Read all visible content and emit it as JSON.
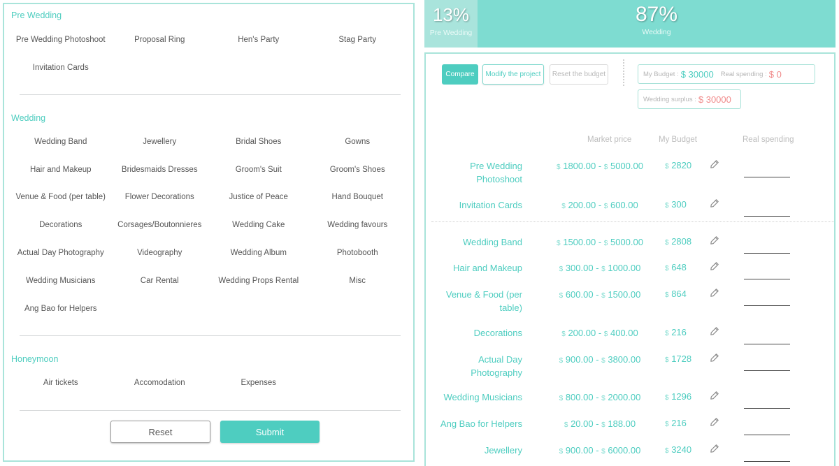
{
  "left": {
    "sections": [
      {
        "title": "Pre Wedding",
        "items": [
          "Pre Wedding Photoshoot",
          "Proposal Ring",
          "Hen's Party",
          "Stag Party",
          "Invitation Cards"
        ]
      },
      {
        "title": "Wedding",
        "items": [
          "Wedding Band",
          "Jewellery",
          "Bridal Shoes",
          "Gowns",
          "Hair and Makeup",
          "Bridesmaids Dresses",
          "Groom's Suit",
          "Groom's Shoes",
          "Venue & Food (per table)",
          "Flower Decorations",
          "Justice of Peace",
          "Hand Bouquet",
          "Decorations",
          "Corsages/Boutonnieres",
          "Wedding Cake",
          "Wedding favours",
          "Actual Day Photography",
          "Videography",
          "Wedding Album",
          "Photobooth",
          "Wedding Musicians",
          "Car Rental",
          "Wedding Props Rental",
          "Misc",
          "Ang Bao for Helpers"
        ]
      },
      {
        "title": "Honeymoon",
        "items": [
          "Air tickets",
          "Accomodation",
          "Expenses"
        ]
      }
    ],
    "reset_label": "Reset",
    "submit_label": "Submit"
  },
  "split": {
    "pre_wedding": {
      "value": "13%",
      "label": "Pre Wedding",
      "percent": 13
    },
    "wedding": {
      "value": "87%",
      "label": "Wedding",
      "percent": 87
    }
  },
  "toolbar": {
    "compare_label": "Compare",
    "modify_label": "Modify the project",
    "reset_budget_label": "Reset the budget"
  },
  "summary": {
    "my_budget_label": "My Budget :",
    "my_budget_value": "$ 30000",
    "real_spending_label": "Real spending :",
    "real_spending_value": "$ 0",
    "surplus_label": "Wedding surplus :",
    "surplus_value": "$ 30000"
  },
  "table": {
    "headers": {
      "market": "Market price",
      "budget": "My Budget",
      "real": "Real spending"
    },
    "currency": "$",
    "rows": [
      {
        "name": "Pre Wedding Photoshoot",
        "market_min": "1800.00",
        "market_max": "5000.00",
        "budget": "2820",
        "real": ""
      },
      {
        "name": "Invitation Cards",
        "market_min": "200.00",
        "market_max": "600.00",
        "budget": "300",
        "real": ""
      },
      {
        "name": "Wedding Band",
        "market_min": "1500.00",
        "market_max": "5000.00",
        "budget": "2808",
        "real": ""
      },
      {
        "name": "Hair and Makeup",
        "market_min": "300.00",
        "market_max": "1000.00",
        "budget": "648",
        "real": ""
      },
      {
        "name": "Venue & Food (per table)",
        "market_min": "600.00",
        "market_max": "1500.00",
        "budget": "864",
        "real": ""
      },
      {
        "name": "Decorations",
        "market_min": "200.00",
        "market_max": "400.00",
        "budget": "216",
        "real": ""
      },
      {
        "name": "Actual Day Photography",
        "market_min": "900.00",
        "market_max": "3800.00",
        "budget": "1728",
        "real": ""
      },
      {
        "name": "Wedding Musicians",
        "market_min": "800.00",
        "market_max": "2000.00",
        "budget": "1296",
        "real": ""
      },
      {
        "name": "Ang Bao for Helpers",
        "market_min": "20.00",
        "market_max": "188.00",
        "budget": "216",
        "real": ""
      },
      {
        "name": "Jewellery",
        "market_min": "900.00",
        "market_max": "6000.00",
        "budget": "3240",
        "real": ""
      }
    ]
  },
  "colors": {
    "accent": "#4ecdc0",
    "accent_light": "#a9e4dc",
    "bar_wedding": "#7edcd1",
    "negative": "#f08a8a"
  }
}
